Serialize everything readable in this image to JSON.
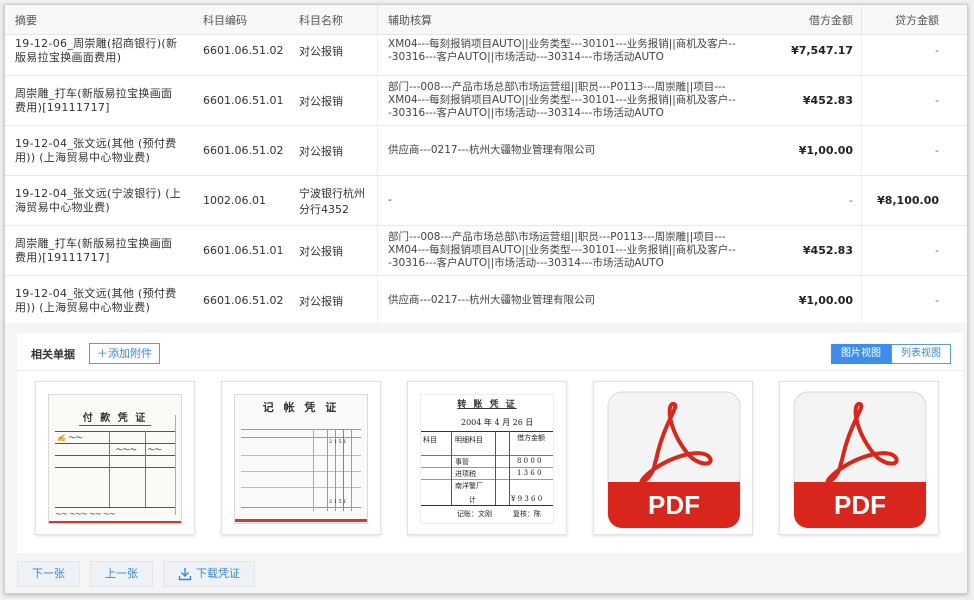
{
  "table": {
    "headers": {
      "summary": "摘要",
      "code": "科目编码",
      "name": "科目名称",
      "aux": "辅助核算",
      "debit": "借方金额",
      "credit": "贷方金额"
    },
    "rows": [
      {
        "summary": "19-12-06_周崇雕(招商银行)(新版易拉宝换画面费用)",
        "code": "6601.06.51.02",
        "name": "对公报销",
        "aux": "XM04---每刻报销项目AUTO||业务类型---30101---业务报销||商机及客户---30316---客户AUTO||市场活动---30314---市场活动AUTO",
        "debit": "¥7,547.17",
        "credit": "-"
      },
      {
        "summary": "周崇雕_打车(新版易拉宝换画面费用)[19111717]",
        "code": "6601.06.51.01",
        "name": "对公报销",
        "aux": "部门---008---产品市场总部\\市场运营组||职员---P0113---周崇雕||项目---XM04---每刻报销项目AUTO||业务类型---30101---业务报销||商机及客户---30316---客户AUTO||市场活动---30314---市场活动AUTO",
        "debit": "¥452.83",
        "credit": "-"
      },
      {
        "summary": "19-12-04_张文远(其他 (预付费用)) (上海贸易中心物业费)",
        "code": "6601.06.51.02",
        "name": "对公报销",
        "aux": "供应商---0217---杭州大疆物业管理有限公司",
        "debit": "¥1,00.00",
        "credit": "-"
      },
      {
        "summary": "19-12-04_张文远(宁波银行) (上海贸易中心物业费)",
        "code": "1002.06.01",
        "name": "宁波银行杭州分行4352",
        "aux": "-",
        "debit": "-",
        "credit": "¥8,100.00"
      },
      {
        "summary": "周崇雕_打车(新版易拉宝换画面费用)[19111717]",
        "code": "6601.06.51.01",
        "name": "对公报销",
        "aux": "部门---008---产品市场总部\\市场运营组||职员---P0113---周崇雕||项目---XM04---每刻报销项目AUTO||业务类型---30101---业务报销||商机及客户---30316---客户AUTO||市场活动---30314---市场活动AUTO",
        "debit": "¥452.83",
        "credit": "-"
      },
      {
        "summary": "19-12-04_张文远(其他 (预付费用)) (上海贸易中心物业费)",
        "code": "6601.06.51.02",
        "name": "对公报销",
        "aux": "供应商---0217---杭州大疆物业管理有限公司",
        "debit": "¥1,00.00",
        "credit": "-"
      }
    ]
  },
  "attachments": {
    "title": "相关单据",
    "add_label": "＋添加附件",
    "view_image": "图片视图",
    "view_list": "列表视图",
    "thumb1_title": "付 款 凭 证",
    "thumb2_title": "记 帐 凭 证",
    "thumb3_title": "转 账 凭 证",
    "thumb3_date": "2004 年 4 月 26 日",
    "thumb3_rows": [
      "科目",
      "明细科目",
      "借方金额",
      "事管",
      "进项税",
      "南洋警厂",
      "计",
      "记账：文刚",
      "复核：陈"
    ],
    "thumb3_amounts": [
      "8 0 0 0",
      "1 3 6 0",
      "¥ 9 3 6 0"
    ],
    "pdf_label": "PDF"
  },
  "footer": {
    "next": "下一张",
    "prev": "上一张",
    "download": "下载凭证"
  },
  "colors": {
    "accent": "#3d8ee8",
    "pdf_red": "#d9261c"
  }
}
